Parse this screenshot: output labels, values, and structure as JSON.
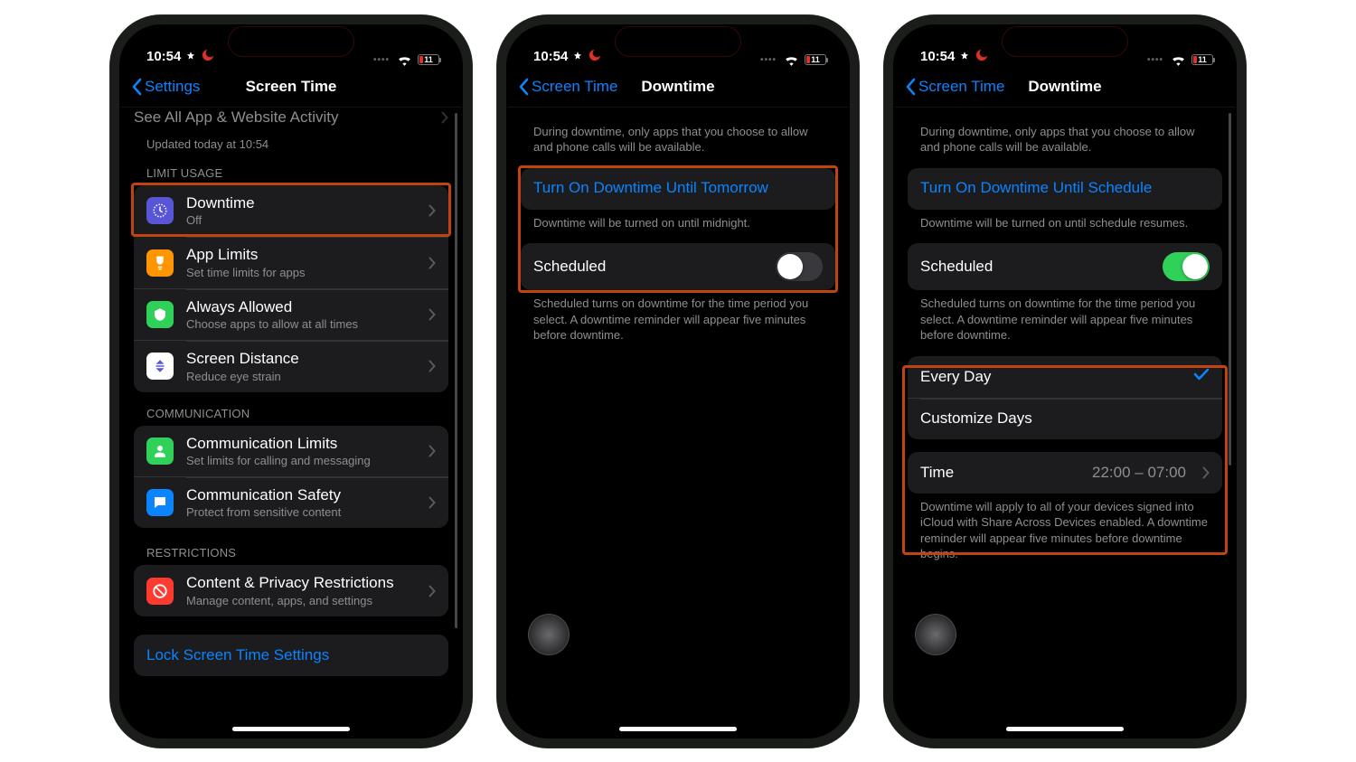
{
  "status": {
    "time": "10:54",
    "battery": "11"
  },
  "phone1": {
    "back": "Settings",
    "title": "Screen Time",
    "cutoff": "See All App & Website Activity",
    "updated": "Updated today at 10:54",
    "sec_limit": "LIMIT USAGE",
    "downtime": {
      "title": "Downtime",
      "sub": "Off"
    },
    "applimits": {
      "title": "App Limits",
      "sub": "Set time limits for apps"
    },
    "always": {
      "title": "Always Allowed",
      "sub": "Choose apps to allow at all times"
    },
    "distance": {
      "title": "Screen Distance",
      "sub": "Reduce eye strain"
    },
    "sec_comm": "COMMUNICATION",
    "commlimits": {
      "title": "Communication Limits",
      "sub": "Set limits for calling and messaging"
    },
    "commsafety": {
      "title": "Communication Safety",
      "sub": "Protect from sensitive content"
    },
    "sec_restrict": "RESTRICTIONS",
    "content": {
      "title": "Content & Privacy Restrictions",
      "sub": "Manage content, apps, and settings"
    },
    "lock": "Lock Screen Time Settings"
  },
  "phone2": {
    "back": "Screen Time",
    "title": "Downtime",
    "intro": "During downtime, only apps that you choose to allow and phone calls will be available.",
    "turn_on": "Turn On Downtime Until Tomorrow",
    "turn_on_desc": "Downtime will be turned on until midnight.",
    "scheduled": "Scheduled",
    "scheduled_desc": "Scheduled turns on downtime for the time period you select. A downtime reminder will appear five minutes before downtime."
  },
  "phone3": {
    "back": "Screen Time",
    "title": "Downtime",
    "intro": "During downtime, only apps that you choose to allow and phone calls will be available.",
    "turn_on": "Turn On Downtime Until Schedule",
    "turn_on_desc": "Downtime will be turned on until schedule resumes.",
    "scheduled": "Scheduled",
    "scheduled_desc": "Scheduled turns on downtime for the time period you select. A downtime reminder will appear five minutes before downtime.",
    "every_day": "Every Day",
    "customize": "Customize Days",
    "time_label": "Time",
    "time_value": "22:00 – 07:00",
    "time_desc": "Downtime will apply to all of your devices signed into iCloud with Share Across Devices enabled. A downtime reminder will appear five minutes before downtime begins."
  }
}
